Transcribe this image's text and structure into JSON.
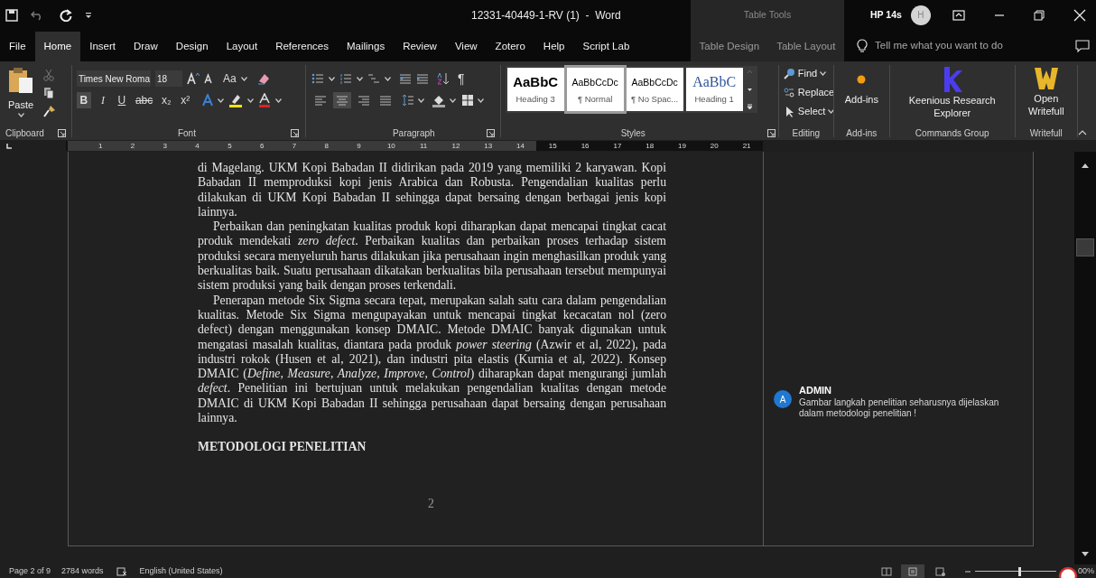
{
  "window": {
    "title": "12331-40449-1-RV (1)  -  Word",
    "contextual_label": "Table Tools",
    "user": "HP 14s",
    "avatar_initial": "H"
  },
  "tabs": [
    {
      "label": "File",
      "selected": false
    },
    {
      "label": "Home",
      "selected": true
    },
    {
      "label": "Insert",
      "selected": false
    },
    {
      "label": "Draw",
      "selected": false
    },
    {
      "label": "Design",
      "selected": false
    },
    {
      "label": "Layout",
      "selected": false
    },
    {
      "label": "References",
      "selected": false
    },
    {
      "label": "Mailings",
      "selected": false
    },
    {
      "label": "Review",
      "selected": false
    },
    {
      "label": "View",
      "selected": false
    },
    {
      "label": "Zotero",
      "selected": false
    },
    {
      "label": "Help",
      "selected": false
    },
    {
      "label": "Script Lab",
      "selected": false
    }
  ],
  "contextual_tabs": [
    {
      "label": "Table Design",
      "selected": false
    },
    {
      "label": "Table Layout",
      "selected": false
    }
  ],
  "tell_me": {
    "placeholder": "Tell me what you want to do"
  },
  "ribbon": {
    "clipboard": {
      "paste": "Paste",
      "label": "Clipboard"
    },
    "font": {
      "name": "Times New Roma",
      "size": "18",
      "case_button": "Aa",
      "format_buttons": [
        {
          "label": "B",
          "kind": "bold",
          "selected": true
        },
        {
          "label": "I",
          "kind": "italic",
          "selected": false
        },
        {
          "label": "U",
          "kind": "underline",
          "selected": false
        },
        {
          "label": "abc",
          "kind": "strike",
          "selected": false
        },
        {
          "label": "x₂",
          "kind": "plain",
          "selected": false
        },
        {
          "label": "x²",
          "kind": "plain",
          "selected": false
        }
      ],
      "label": "Font"
    },
    "paragraph": {
      "pilcrow": "¶",
      "alignment": [
        {
          "selected": false
        },
        {
          "selected": true
        },
        {
          "selected": false
        },
        {
          "selected": false
        }
      ],
      "label": "Paragraph"
    },
    "styles": {
      "items": [
        {
          "preview": "AaBbC",
          "name": "Heading 3",
          "kind": "heading3",
          "selected": false
        },
        {
          "preview": "AaBbCcDc",
          "name": "¶ Normal",
          "kind": "normal",
          "selected": true
        },
        {
          "preview": "AaBbCcDc",
          "name": "¶ No Spac...",
          "kind": "normal",
          "selected": false
        },
        {
          "preview": "AaBbC",
          "name": "Heading 1",
          "kind": "heading1",
          "selected": false
        }
      ],
      "label": "Styles"
    },
    "editing": {
      "items": [
        {
          "label": "Find",
          "kind": "find"
        },
        {
          "label": "Replace",
          "kind": "replace"
        },
        {
          "label": "Select",
          "kind": "select"
        }
      ],
      "label": "Editing"
    },
    "addins": {
      "button": "Add-ins",
      "label": "Add-ins"
    },
    "keenious": {
      "button": "Keenious Research Explorer",
      "label": "Commands Group"
    },
    "writefull": {
      "button": "Open Writefull",
      "label": "Writefull"
    }
  },
  "ruler": {
    "ticks": [
      "1",
      "2",
      "3",
      "4",
      "5",
      "6",
      "7",
      "8",
      "9",
      "10",
      "11",
      "12",
      "13",
      "14",
      "15",
      "16",
      "17",
      "18",
      "19",
      "20",
      "21"
    ]
  },
  "document": {
    "paragraphs": [
      {
        "text": "di Magelang. UKM Kopi Babadan II didirikan pada 2019 yang memiliki 2 karyawan. Kopi Babadan II memproduksi kopi jenis Arabica dan Robusta. Pengendalian kualitas perlu dilakukan di UKM Kopi Babadan II sehingga dapat bersaing dengan berbagai jenis kopi lainnya.",
        "indent": false
      },
      {
        "text": "Perbaikan dan peningkatan kualitas produk kopi diharapkan dapat mencapai tingkat cacat produk mendekati *zero defect*. Perbaikan kualitas dan perbaikan proses terhadap sistem produksi secara menyeluruh harus dilakukan jika perusahaan ingin menghasilkan produk yang berkualitas baik. Suatu perusahaan dikatakan berkualitas bila perusahaan tersebut mempunyai sistem produksi yang baik dengan proses terkendali.",
        "indent": true
      },
      {
        "text": "Penerapan metode Six Sigma secara tepat, merupakan salah satu cara dalam pengendalian kualitas. Metode Six Sigma mengupayakan untuk mencapai tingkat kecacatan nol (zero defect) dengan menggunakan konsep DMAIC. Metode DMAIC banyak digunakan untuk mengatasi masalah kualitas, diantara pada produk *power steering* (Azwir et al, 2022), pada industri rokok (Husen et al, 2021), dan industri pita elastis (Kurnia et al, 2022). Konsep DMAIC (*Define, Measure, Analyze, Improve, Control*) diharapkan dapat mengurangi jumlah *defect*. Penelitian ini bertujuan untuk melakukan pengendalian kualitas dengan metode DMAIC di UKM Kopi Babadan II sehingga perusahaan dapat bersaing dengan perusahaan lainnya.",
        "indent": true
      }
    ],
    "heading": "METODOLOGI PENELITIAN",
    "page_number": "2"
  },
  "comment": {
    "initial": "A",
    "author": "ADMIN",
    "text": "Gambar langkah penelitian seharusnya dijelaskan dalam metodologi penelitian !"
  },
  "status_bar": {
    "page": "Page 2 of 9",
    "words": "2784 words",
    "language": "English (United States)",
    "zoom": "00%",
    "zoom_slider": {
      "level": 0.55
    }
  }
}
